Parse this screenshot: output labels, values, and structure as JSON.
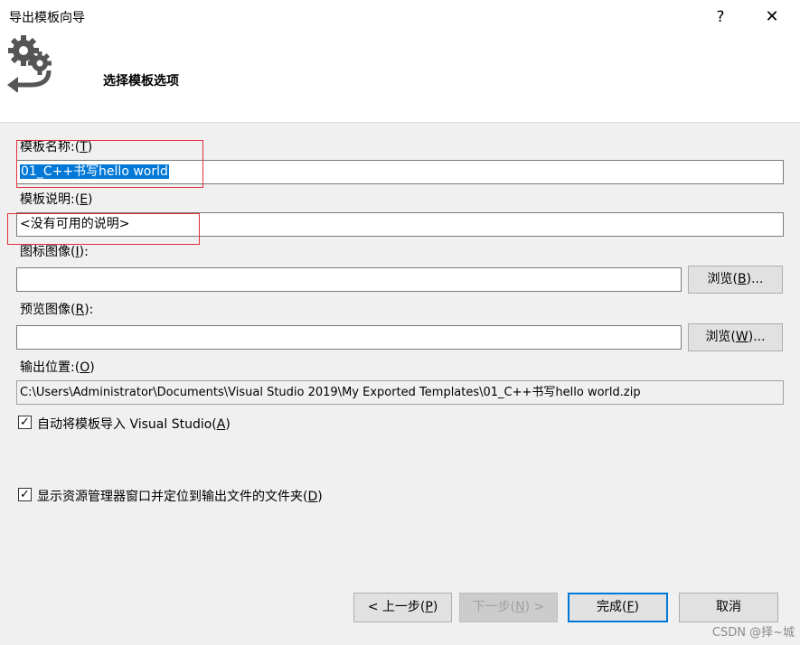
{
  "window": {
    "title": "导出模板向导",
    "help": "?",
    "close": "✕"
  },
  "header": {
    "title": "选择模板选项"
  },
  "fields": {
    "name_label_pre": "模板名称:(",
    "name_label_key": "T",
    "name_label_post": ")",
    "name_value": "01_C++书写hello world",
    "desc_label_pre": "模板说明:(",
    "desc_label_key": "E",
    "desc_label_post": ")",
    "desc_value": "<没有可用的说明>",
    "icon_label_pre": "图标图像(",
    "icon_label_key": "I",
    "icon_label_post": "):",
    "icon_value": "",
    "icon_browse_pre": "浏览(",
    "icon_browse_key": "B",
    "icon_browse_post": ")...",
    "preview_label_pre": "预览图像(",
    "preview_label_key": "R",
    "preview_label_post": "):",
    "preview_value": "",
    "preview_browse_pre": "浏览(",
    "preview_browse_key": "W",
    "preview_browse_post": ")...",
    "output_label_pre": "输出位置:(",
    "output_label_key": "O",
    "output_label_post": ")",
    "output_value": "C:\\Users\\Administrator\\Documents\\Visual Studio 2019\\My Exported Templates\\01_C++书写hello world.zip"
  },
  "options": {
    "auto_import_pre": "自动将模板导入 Visual Studio(",
    "auto_import_key": "A",
    "auto_import_post": ")",
    "auto_import_checked": true,
    "show_explorer_pre": "显示资源管理器窗口并定位到输出文件的文件夹(",
    "show_explorer_key": "D",
    "show_explorer_post": ")",
    "show_explorer_checked": true,
    "check_glyph": "✓"
  },
  "buttons": {
    "prev_pre": "< 上一步(",
    "prev_key": "P",
    "prev_post": ")",
    "next_pre": "下一步(",
    "next_key": "N",
    "next_post": ") >",
    "finish_pre": "完成(",
    "finish_key": "F",
    "finish_post": ")",
    "cancel": "取消"
  },
  "watermark": "CSDN @择~城",
  "colors": {
    "selection": "#0078d7",
    "annotation_red": "#e0303a"
  }
}
